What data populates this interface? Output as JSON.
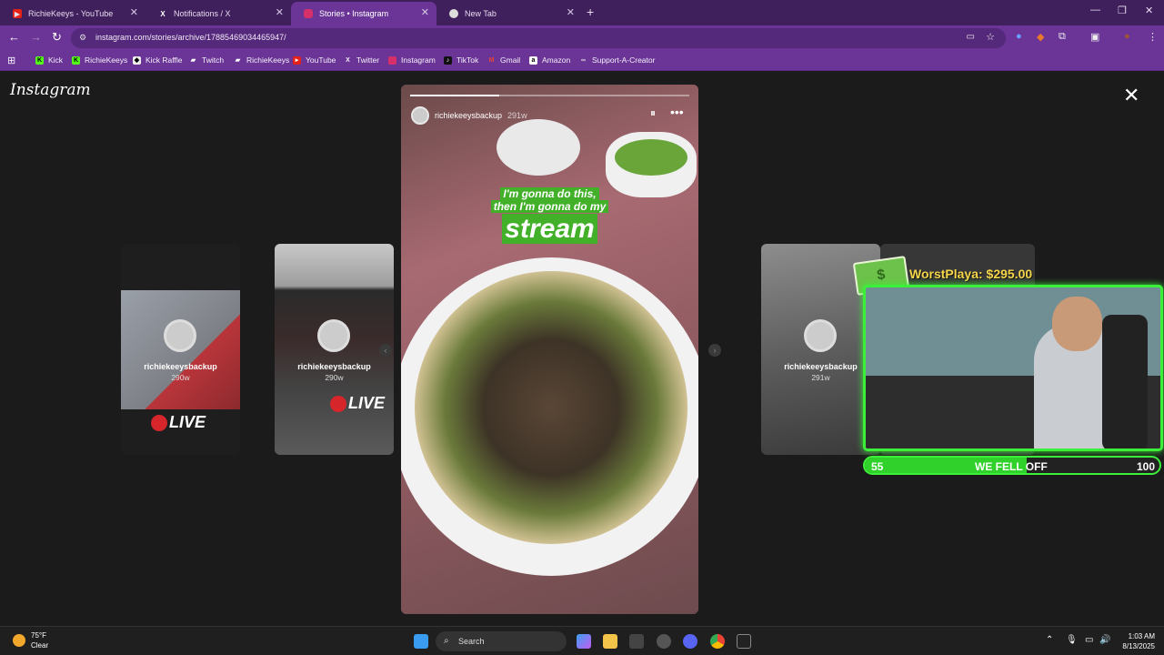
{
  "browser": {
    "tabs": [
      {
        "title": "RichieKeeys - YouTube",
        "icon": "youtube-icon"
      },
      {
        "title": "Notifications / X",
        "icon": "x-icon"
      },
      {
        "title": "Stories • Instagram",
        "icon": "instagram-icon"
      },
      {
        "title": "New Tab",
        "icon": "chrome-icon"
      }
    ],
    "url": "instagram.com/stories/archive/17885469034465947/",
    "bookmarks": [
      "Kick",
      "RichieKeeys",
      "Kick Raffle",
      "Twitch",
      "RichieKeeys",
      "YouTube",
      "Twitter",
      "Instagram",
      "TikTok",
      "Gmail",
      "Amazon",
      "Support-A-Creator"
    ]
  },
  "page": {
    "logo": "Instagram",
    "previews": [
      {
        "username": "richiekeeysbackup",
        "time": "290w",
        "badge": "LIVE"
      },
      {
        "username": "richiekeeysbackup",
        "time": "290w",
        "badge": "LIVE"
      },
      {
        "username": "richiekeeysbackup",
        "time": "291w"
      }
    ],
    "story": {
      "username": "richiekeeysbackup",
      "time": "291w",
      "caption_line1": "I'm gonna do this,",
      "caption_line2": "then I'm gonna do my",
      "caption_big": "stream",
      "progress": 0.32
    }
  },
  "overlay": {
    "donor_text": "WorstPlaya: $295.00",
    "bar_left": "55",
    "bar_mid": "WE FELL OFF",
    "bar_right": "100",
    "bar_fill": 0.55,
    "accent": "#3cf03a"
  },
  "taskbar": {
    "temp": "75°F",
    "condition": "Clear",
    "search": "Search",
    "time": "1:03 AM",
    "date": "8/13/2025"
  }
}
